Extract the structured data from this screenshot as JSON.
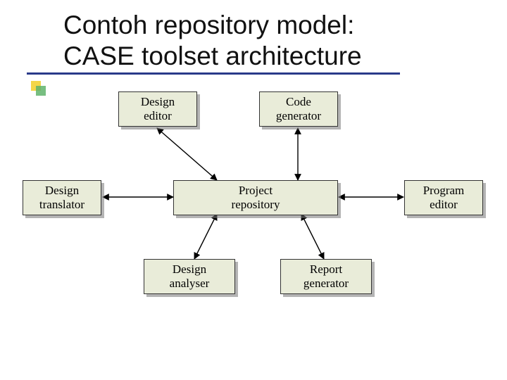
{
  "title_line1": "Contoh repository model:",
  "title_line2": "CASE toolset architecture",
  "nodes": {
    "design_editor": "Design\neditor",
    "code_generator": "Code\ngenerator",
    "design_translator": "Design\ntranslator",
    "project_repository": "Project\nrepository",
    "program_editor": "Program\neditor",
    "design_analyser": "Design\nanalyser",
    "report_generator": "Report\ngenerator"
  },
  "colors": {
    "underline": "#2a3a8a",
    "node_fill": "#e9ecd9"
  }
}
